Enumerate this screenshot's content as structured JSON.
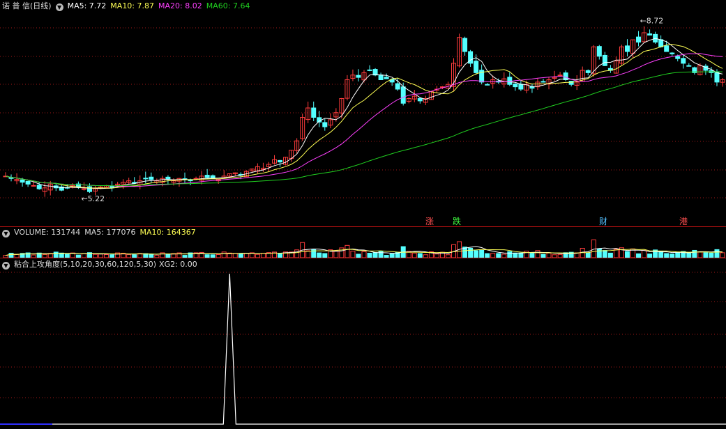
{
  "price_header": {
    "title": "诺 普 信(日线)",
    "ma5": "MA5: 7.72",
    "ma10": "MA10: 7.87",
    "ma20": "MA20: 8.02",
    "ma60": "MA60: 7.64"
  },
  "volume_header": {
    "title": "VOLUME: 131744",
    "ma5": "MA5: 177076",
    "ma10": "MA10: 164367"
  },
  "indicator_header": {
    "title": "粘合上攻角度(5,10,20,30,60,120,5,30)",
    "xg2": "XG2: 0.00"
  },
  "colors": {
    "up": "#ff3c3c",
    "down": "#54ffff",
    "ma5": "#ffffff",
    "ma10": "#ffff54",
    "ma20": "#ff40ff",
    "ma60": "#20d020",
    "grid": "#a01818"
  },
  "price_labels": {
    "low": "5.22",
    "high": "8.72"
  },
  "event_markers": [
    "涨",
    "跌",
    "财",
    "港"
  ],
  "chart_data": {
    "type": "candlestick",
    "ylim": [
      5.0,
      9.0
    ],
    "series_closes": [
      5.55,
      5.5,
      5.48,
      5.42,
      5.38,
      5.35,
      5.28,
      5.3,
      5.38,
      5.3,
      5.25,
      5.3,
      5.35,
      5.32,
      5.28,
      5.22,
      5.28,
      5.32,
      5.35,
      5.3,
      5.38,
      5.42,
      5.45,
      5.4,
      5.45,
      5.5,
      5.48,
      5.45,
      5.5,
      5.48,
      5.45,
      5.5,
      5.48,
      5.45,
      5.5,
      5.55,
      5.52,
      5.5,
      5.48,
      5.55,
      5.6,
      5.62,
      5.58,
      5.65,
      5.7,
      5.75,
      5.72,
      5.8,
      5.9,
      5.85,
      5.95,
      6.1,
      6.3,
      6.8,
      7.0,
      6.8,
      6.7,
      6.6,
      6.75,
      6.9,
      7.2,
      7.6,
      7.7,
      7.65,
      7.75,
      7.8,
      7.7,
      7.6,
      7.62,
      7.55,
      7.4,
      7.1,
      7.2,
      7.25,
      7.15,
      7.2,
      7.35,
      7.4,
      7.45,
      7.5,
      7.95,
      8.5,
      8.2,
      7.95,
      7.75,
      7.55,
      7.5,
      7.6,
      7.55,
      7.62,
      7.5,
      7.45,
      7.4,
      7.5,
      7.42,
      7.55,
      7.55,
      7.6,
      7.65,
      7.7,
      7.6,
      7.5,
      7.55,
      7.8,
      7.75,
      8.3,
      8.1,
      7.9,
      7.8,
      8.0,
      8.3,
      8.2,
      8.45,
      8.4,
      8.6,
      8.55,
      8.4,
      8.3,
      8.2,
      8.15,
      8.05,
      7.95,
      7.9,
      7.75,
      7.9,
      7.8,
      7.75,
      7.55,
      7.6
    ],
    "volume_ylim": [
      0,
      500000
    ],
    "indicator_peak_index": 40,
    "indicator_ylim": [
      0,
      100
    ],
    "indicator_peak_value": 100
  }
}
